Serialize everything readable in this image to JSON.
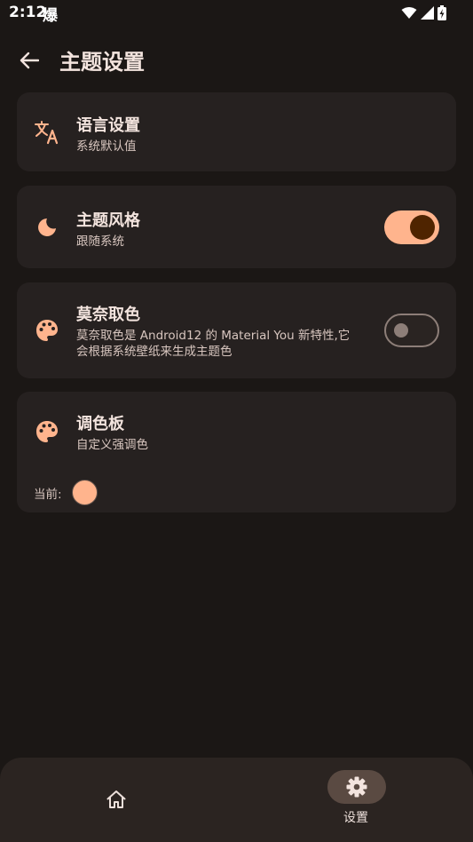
{
  "status_bar": {
    "time": "2:12",
    "extra": "爆"
  },
  "app_bar": {
    "title": "主题设置"
  },
  "settings": {
    "language": {
      "title": "语言设置",
      "subtitle": "系统默认值"
    },
    "theme_style": {
      "title": "主题风格",
      "subtitle": "跟随系统",
      "enabled": true
    },
    "monet": {
      "title": "莫奈取色",
      "subtitle_line1": "莫奈取色是 Android12 的 Material You 新特性,它",
      "subtitle_line2": "会根据系统壁纸来生成主题色",
      "enabled": false
    },
    "palette": {
      "title": "调色板",
      "subtitle": "自定义强调色",
      "current_label": "当前:",
      "current_color": "#ffb48d"
    }
  },
  "bottom_nav": {
    "items": [
      {
        "id": "home",
        "icon": "home-icon",
        "label": ""
      },
      {
        "id": "settings",
        "icon": "gear-icon",
        "label": "设置",
        "selected": true
      }
    ]
  },
  "colors": {
    "accent": "#ffb48d",
    "background": "#1b1715",
    "card": "#262120"
  }
}
